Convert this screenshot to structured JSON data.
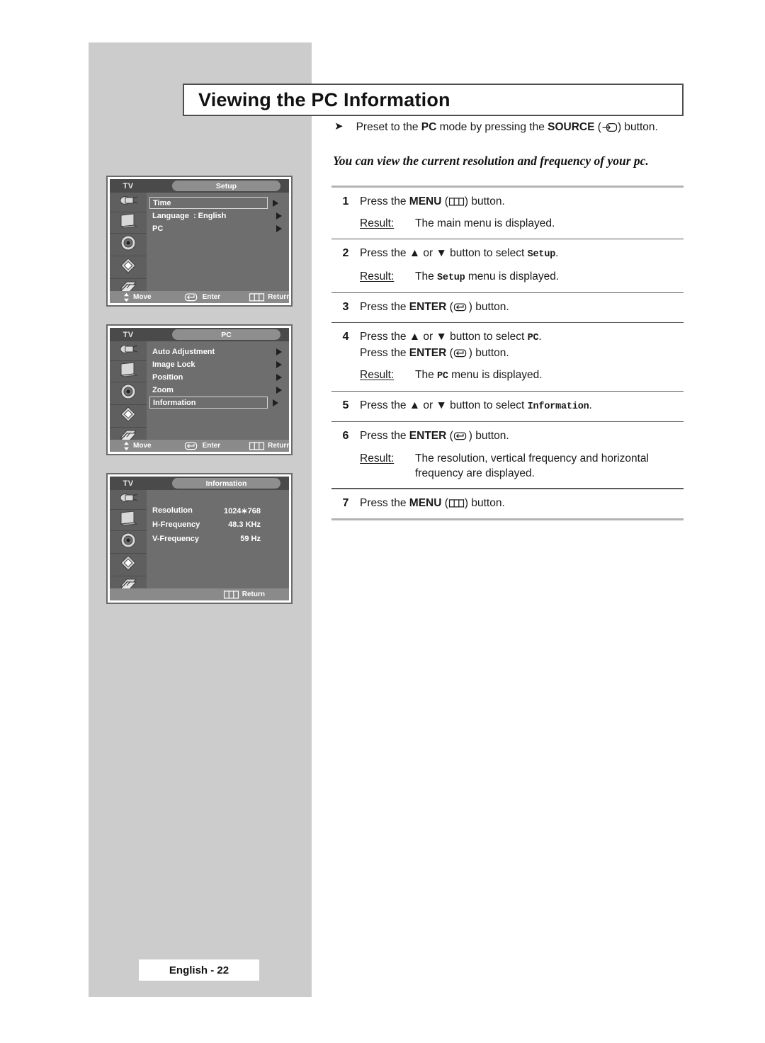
{
  "page": {
    "title": "Viewing the PC Information",
    "footer_label": "English - 22",
    "intro_bullet": {
      "pre": "Preset to the ",
      "bold1": "PC",
      "mid": " mode by pressing the ",
      "bold2": "SOURCE",
      "icon": "source-icon",
      "post": " button."
    },
    "subtitle": "You can view the current resolution and frequency of your pc."
  },
  "steps": [
    {
      "num": "1",
      "lines": [
        {
          "pre": "Press the ",
          "bold": "MENU",
          "icon": "menu-icon",
          "post": " button."
        }
      ],
      "result_label": "Result:",
      "result_parts": [
        {
          "text": "The main menu is displayed.",
          "style": "normal"
        }
      ]
    },
    {
      "num": "2",
      "lines": [
        {
          "pre": "Press the ▲ or ▼ button to select ",
          "mono": "Setup",
          "post": "."
        }
      ],
      "result_label": "Result:",
      "result_parts": [
        {
          "text": "The ",
          "style": "normal"
        },
        {
          "text": "Setup",
          "style": "mono"
        },
        {
          "text": " menu is displayed.",
          "style": "normal"
        }
      ]
    },
    {
      "num": "3",
      "lines": [
        {
          "pre": "Press the ",
          "bold": "ENTER",
          "icon": "enter-icon",
          "post": " button."
        }
      ]
    },
    {
      "num": "4",
      "lines": [
        {
          "pre": "Press the ▲ or ▼ button to select ",
          "mono": "PC",
          "post": "."
        },
        {
          "pre": "Press the ",
          "bold": "ENTER",
          "icon": "enter-icon",
          "post": " button."
        }
      ],
      "result_label": "Result:",
      "result_parts": [
        {
          "text": "The ",
          "style": "normal"
        },
        {
          "text": "PC",
          "style": "mono"
        },
        {
          "text": " menu is displayed.",
          "style": "normal"
        }
      ]
    },
    {
      "num": "5",
      "lines": [
        {
          "pre": "Press the ▲ or ▼ button to select ",
          "mono": "Information",
          "post": "."
        }
      ]
    },
    {
      "num": "6",
      "lines": [
        {
          "pre": "Press the ",
          "bold": "ENTER",
          "icon": "enter-icon",
          "post": " button."
        }
      ],
      "result_label": "Result:",
      "result_parts": [
        {
          "text": "The resolution, vertical frequency and horizontal frequency are displayed.",
          "style": "normal"
        }
      ]
    },
    {
      "num": "7",
      "lines": [
        {
          "pre": "Press the ",
          "bold": "MENU",
          "icon": "menu-icon",
          "post": " button."
        }
      ]
    }
  ],
  "osd_screens": [
    {
      "tv_label": "TV",
      "menu_title": "Setup",
      "rows": [
        {
          "label": "Time",
          "value": "",
          "selected": true,
          "arrow": true
        },
        {
          "label": "Language",
          "value": ": English",
          "selected": false,
          "arrow": true
        },
        {
          "label": "PC",
          "value": "",
          "selected": false,
          "arrow": true
        }
      ],
      "footer": [
        {
          "glyph": "updown-icon",
          "label": "Move"
        },
        {
          "glyph": "enter-icon",
          "label": "Enter"
        },
        {
          "glyph": "menu-icon",
          "label": "Return"
        }
      ]
    },
    {
      "tv_label": "TV",
      "menu_title": "PC",
      "rows": [
        {
          "label": "Auto Adjustment",
          "value": "",
          "selected": false,
          "arrow": true
        },
        {
          "label": "Image Lock",
          "value": "",
          "selected": false,
          "arrow": true
        },
        {
          "label": "Position",
          "value": "",
          "selected": false,
          "arrow": true
        },
        {
          "label": "Zoom",
          "value": "",
          "selected": false,
          "arrow": true
        },
        {
          "label": "Information",
          "value": "",
          "selected": true,
          "arrow": true
        }
      ],
      "footer": [
        {
          "glyph": "updown-icon",
          "label": "Move"
        },
        {
          "glyph": "enter-icon",
          "label": "Enter"
        },
        {
          "glyph": "menu-icon",
          "label": "Return"
        }
      ]
    },
    {
      "tv_label": "TV",
      "menu_title": "Information",
      "info_rows": [
        {
          "label": "Resolution",
          "value": "1024∗768"
        },
        {
          "label": "H-Frequency",
          "value": "48.3  KHz"
        },
        {
          "label": "V-Frequency",
          "value": "59  Hz"
        }
      ],
      "footer": [
        {
          "glyph": "menu-icon",
          "label": "Return"
        }
      ]
    }
  ],
  "sidebar_icons": [
    "input-jack-icon",
    "picture-tv-icon",
    "speaker-icon",
    "chip-setup-icon",
    "cards-stack-icon"
  ],
  "colors": {
    "page_panel": "#cccccc",
    "osd_body": "#6e6e6e",
    "osd_header": "#4a4a4a",
    "osd_footer": "#8a8a8a",
    "rule_light": "#b3b3b3",
    "rule_dark": "#5a5a5a"
  }
}
